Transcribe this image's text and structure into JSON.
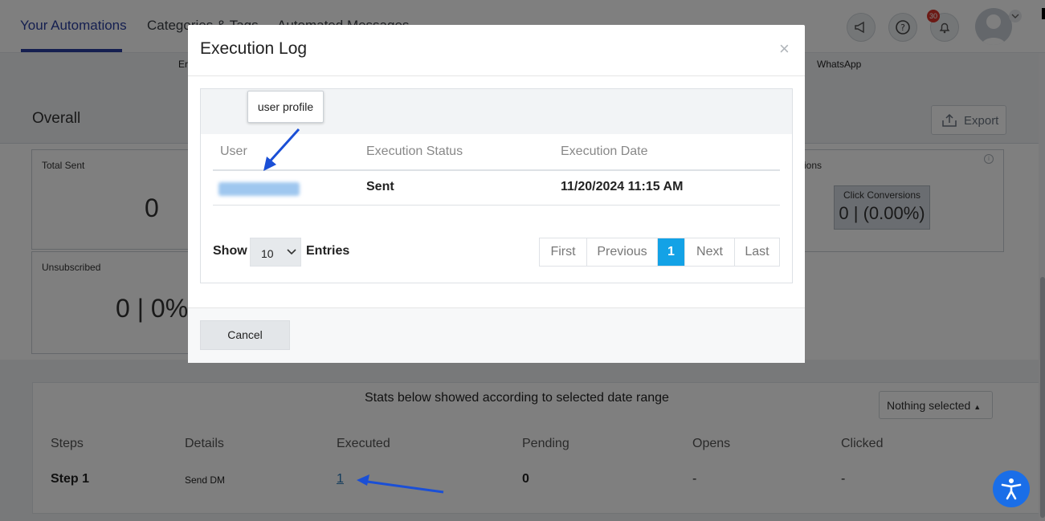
{
  "nav": {
    "tabs": [
      "Your Automations",
      "Categories & Tags",
      "Automated Messages"
    ],
    "active_tab": "Your Automations",
    "notification_count": "30"
  },
  "channels": {
    "left_label": "Er",
    "right_label": "WhatsApp"
  },
  "overall": {
    "title": "Overall",
    "export_label": "Export",
    "total_sent_label": "Total Sent",
    "total_sent_value": "0",
    "unsubscribed_label": "Unsubscribed",
    "unsubscribed_value": "0 | 0%",
    "conversions_label": "ions",
    "click_conversions_label": "Click Conversions",
    "click_conversions_value": "0 | (0.00%)"
  },
  "steps": {
    "range_text": "Stats below showed according to selected date range",
    "filter_label": "Nothing selected",
    "headers": [
      "Steps",
      "Details",
      "Executed",
      "Pending",
      "Opens",
      "Clicked"
    ],
    "row": {
      "step": "Step 1",
      "details": "Send DM",
      "executed": "1",
      "pending": "0",
      "opens": "-",
      "clicked": "-"
    }
  },
  "modal": {
    "title": "Execution Log",
    "close_symbol": "×",
    "tooltip": "user profile",
    "headers": [
      "User",
      "Execution Status",
      "Execution Date"
    ],
    "row": {
      "status": "Sent",
      "date": "11/20/2024 11:15 AM"
    },
    "show_label": "Show",
    "entries_value": "10",
    "entries_label": "Entries",
    "pager": [
      "First",
      "Previous",
      "1",
      "Next",
      "Last"
    ],
    "active_page": "1",
    "cancel_label": "Cancel"
  },
  "colors": {
    "accent_nav": "#2a3fa0",
    "pager_active": "#13a2e6",
    "annotation_arrow": "#1a4fd6",
    "notification_badge": "#d9342b",
    "accessibility_button": "#1a6ee8"
  }
}
